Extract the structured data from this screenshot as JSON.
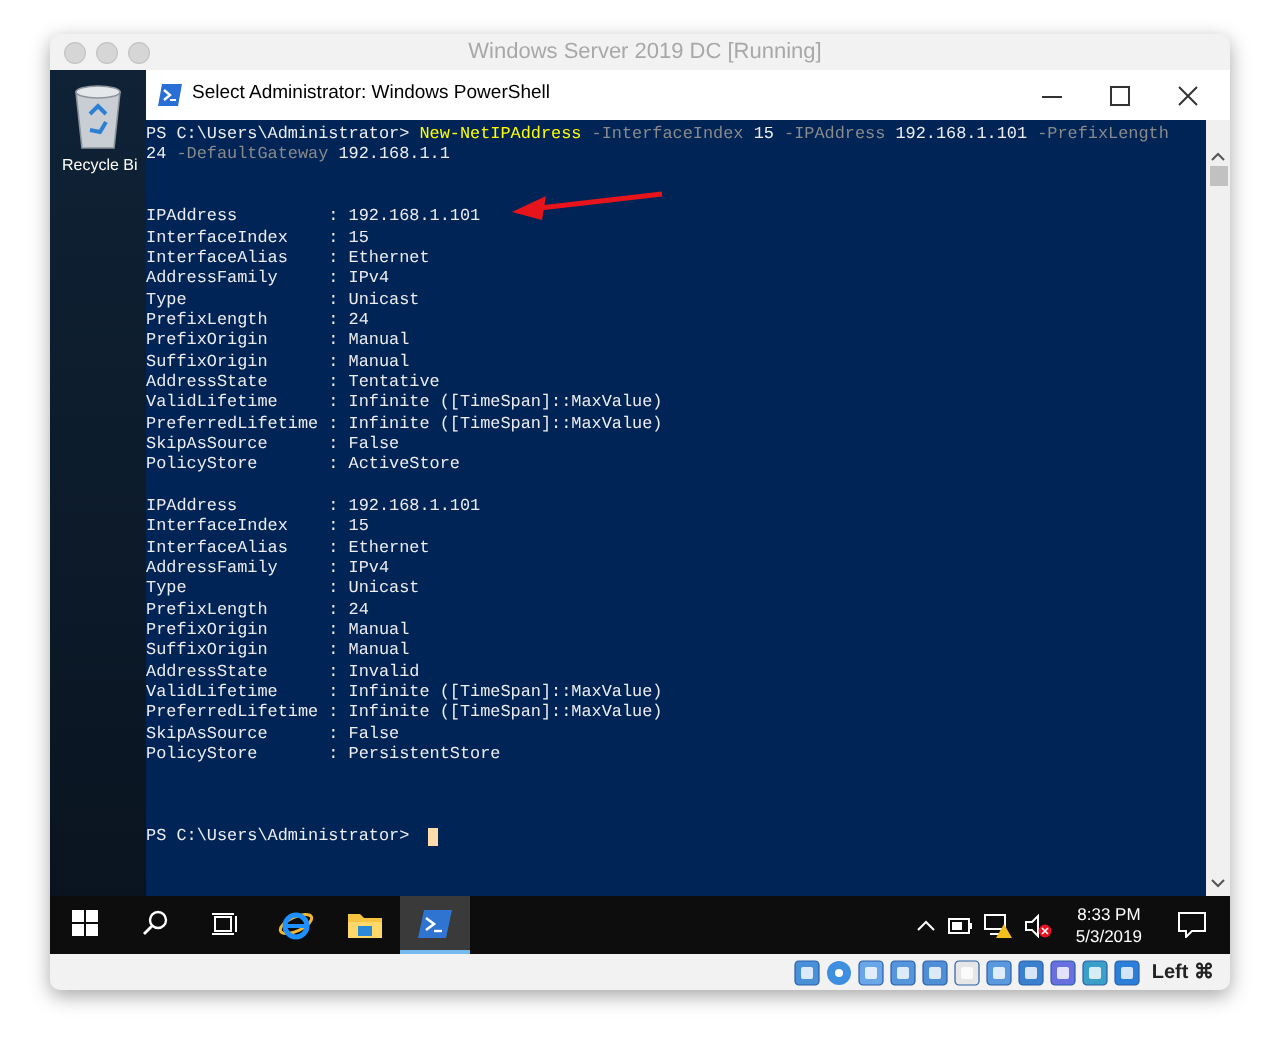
{
  "window": {
    "title": "Windows Server 2019 DC [Running]"
  },
  "desktop": {
    "icons": [
      {
        "label": "Recycle Bi"
      }
    ]
  },
  "powershell": {
    "title": "Select Administrator: Windows PowerShell",
    "lines": [
      [
        {
          "kind": "prompt",
          "text": "PS C:\\Users\\Administrator> "
        },
        {
          "kind": "command",
          "text": "New-NetIPAddress"
        },
        {
          "kind": "parameter",
          "text": " -InterfaceIndex"
        },
        {
          "kind": "argument",
          "text": " 15"
        },
        {
          "kind": "parameter",
          "text": " -IPAddress"
        },
        {
          "kind": "argument",
          "text": " 192.168.1.101"
        },
        {
          "kind": "parameter",
          "text": " -PrefixLength"
        }
      ],
      [
        {
          "kind": "argument",
          "text": "24"
        },
        {
          "kind": "parameter",
          "text": " -DefaultGateway"
        },
        {
          "kind": "argument",
          "text": " 192.168.1.1"
        }
      ],
      {
        "kind": "break"
      },
      [
        {
          "kind": "output",
          "text": "IPAddress         : 192.168.1.101"
        }
      ],
      [
        {
          "kind": "output",
          "text": "InterfaceIndex    : 15"
        }
      ],
      [
        {
          "kind": "output",
          "text": "InterfaceAlias    : Ethernet"
        }
      ],
      [
        {
          "kind": "output",
          "text": "AddressFamily     : IPv4"
        }
      ],
      [
        {
          "kind": "output",
          "text": "Type              : Unicast"
        }
      ],
      [
        {
          "kind": "output",
          "text": "PrefixLength      : 24"
        }
      ],
      [
        {
          "kind": "output",
          "text": "PrefixOrigin      : Manual"
        }
      ],
      [
        {
          "kind": "output",
          "text": "SuffixOrigin      : Manual"
        }
      ],
      [
        {
          "kind": "output",
          "text": "AddressState      : Tentative"
        }
      ],
      [
        {
          "kind": "output",
          "text": "ValidLifetime     : Infinite ([TimeSpan]::MaxValue)"
        }
      ],
      [
        {
          "kind": "output",
          "text": "PreferredLifetime : Infinite ([TimeSpan]::MaxValue)"
        }
      ],
      [
        {
          "kind": "output",
          "text": "SkipAsSource      : False"
        }
      ],
      [
        {
          "kind": "output",
          "text": "PolicyStore       : ActiveStore"
        }
      ],
      {
        "kind": "break"
      },
      [
        {
          "kind": "output",
          "text": "IPAddress         : 192.168.1.101"
        }
      ],
      [
        {
          "kind": "output",
          "text": "InterfaceIndex    : 15"
        }
      ],
      [
        {
          "kind": "output",
          "text": "InterfaceAlias    : Ethernet"
        }
      ],
      [
        {
          "kind": "output",
          "text": "AddressFamily     : IPv4"
        }
      ],
      [
        {
          "kind": "output",
          "text": "Type              : Unicast"
        }
      ],
      [
        {
          "kind": "output",
          "text": "PrefixLength      : 24"
        }
      ],
      [
        {
          "kind": "output",
          "text": "PrefixOrigin      : Manual"
        }
      ],
      [
        {
          "kind": "output",
          "text": "SuffixOrigin      : Manual"
        }
      ],
      [
        {
          "kind": "output",
          "text": "AddressState      : Invalid"
        }
      ],
      [
        {
          "kind": "output",
          "text": "ValidLifetime     : Infinite ([TimeSpan]::MaxValue)"
        }
      ],
      [
        {
          "kind": "output",
          "text": "PreferredLifetime : Infinite ([TimeSpan]::MaxValue)"
        }
      ],
      [
        {
          "kind": "output",
          "text": "SkipAsSource      : False"
        }
      ],
      [
        {
          "kind": "output",
          "text": "PolicyStore       : PersistentStore"
        }
      ],
      {
        "kind": "break"
      },
      [
        {
          "kind": "prompt",
          "text": "PS C:\\Users\\Administrator> "
        },
        {
          "kind": "cursor"
        }
      ]
    ]
  },
  "taskbar": {
    "items": [
      {
        "kind": "start",
        "selected": false
      },
      {
        "kind": "search",
        "selected": false
      },
      {
        "kind": "taskview",
        "selected": false
      },
      {
        "kind": "browser",
        "selected": false
      },
      {
        "kind": "folder",
        "selected": false
      },
      {
        "kind": "terminal",
        "selected": true
      }
    ],
    "clock": {
      "time": "8:33 PM",
      "date": "5/3/2019"
    }
  },
  "status_bar": {
    "host_key": "Left ⌘"
  }
}
